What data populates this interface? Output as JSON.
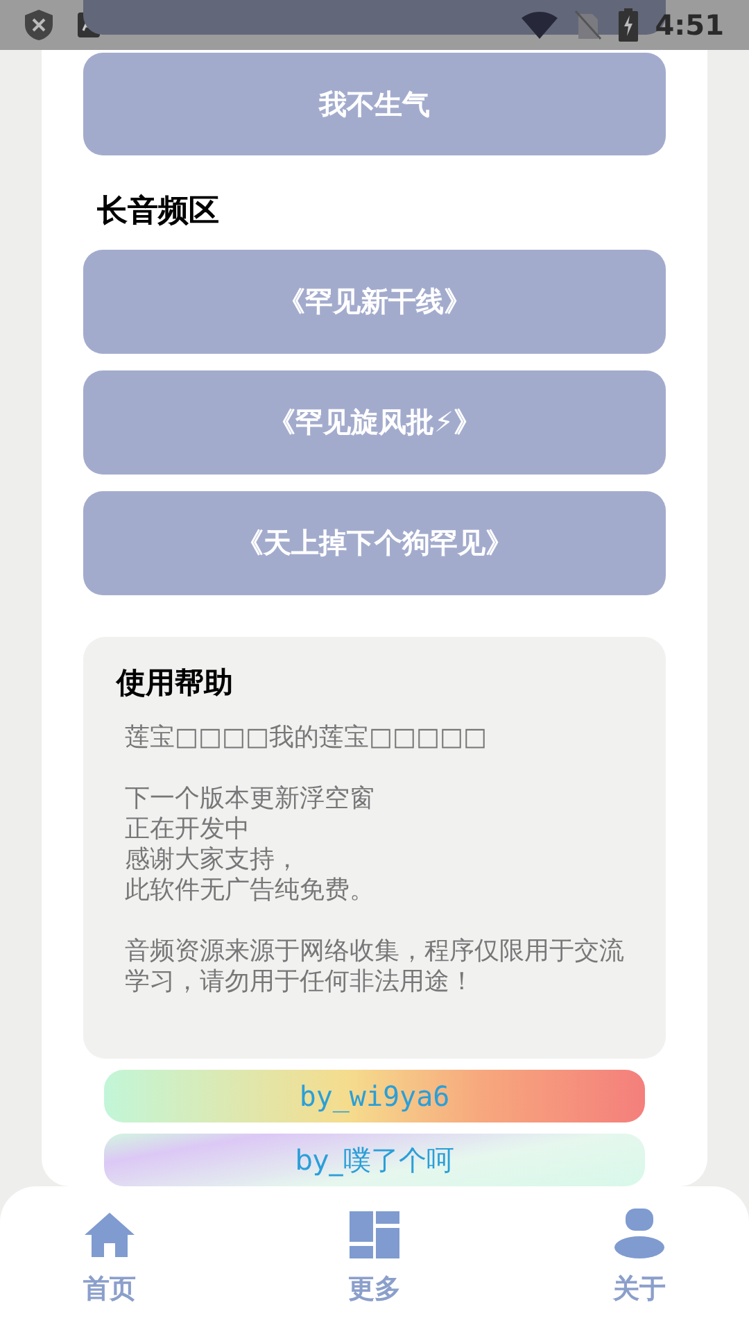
{
  "status_bar": {
    "time": "4:51"
  },
  "top_button": {
    "label": "我不生气"
  },
  "section": {
    "title": "长音频区",
    "buttons": [
      {
        "label": "《罕见新干线》"
      },
      {
        "label": "《罕见旋风批⚡》"
      },
      {
        "label": "《天上掉下个狗罕见》"
      }
    ]
  },
  "help": {
    "title": "使用帮助",
    "paragraphs": [
      [
        "莲宝□□□□我的莲宝□□□□□"
      ],
      [
        "下一个版本更新浮空窗",
        "正在开发中",
        "感谢大家支持，",
        "此软件无广告纯免费。"
      ],
      [
        "音频资源来源于网络收集，程序仅限用于交流学习，请勿用于任何非法用途！"
      ]
    ]
  },
  "credits": [
    {
      "label": "by_wi9ya6",
      "kind": "warm"
    },
    {
      "label": "by_噗了个呵",
      "kind": "cool"
    }
  ],
  "nav": [
    {
      "label": "首页",
      "kind": "home"
    },
    {
      "label": "更多",
      "kind": "more"
    },
    {
      "label": "关于",
      "kind": "about"
    }
  ]
}
